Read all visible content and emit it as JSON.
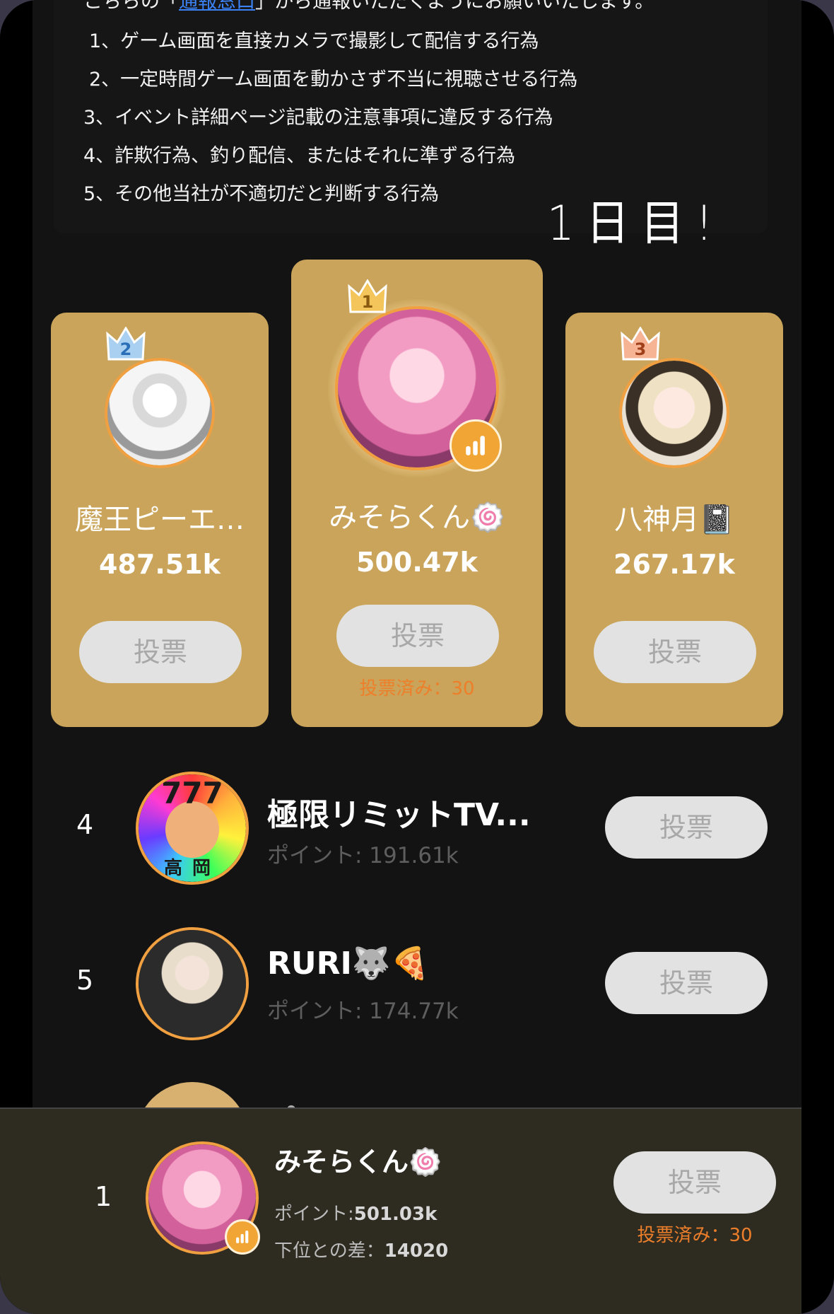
{
  "rules": {
    "line0_prefix": "こちらの「",
    "line0_link": "通報窓口",
    "line0_suffix": "」から通報いただくようにお願いいたします。",
    "items": [
      "1、ゲーム画面を直接カメラで撮影して配信する行為",
      "2、一定時間ゲーム画面を動かさず不当に視聴させる行為",
      "3、イベント詳細ページ記載の注意事項に違反する行為",
      "4、詐欺行為、釣り配信、またはそれに準ずる行為",
      "5、その他当社が不適切だと判断する行為"
    ],
    "handwritten_note": "1日目!"
  },
  "podium": [
    {
      "rank": "2",
      "name": "魔王ピーエ…",
      "score": "487.51k",
      "vote_label": "投票",
      "avatar_colors": [
        "#f4f4f4",
        "#888888"
      ],
      "crown_color": "#9fc9ee"
    },
    {
      "rank": "1",
      "name": "みそらくん",
      "emoji": "🍥",
      "score": "500.47k",
      "vote_label": "投票",
      "voted_text": "投票済み：30",
      "avatar_colors": [
        "#f5a5c8",
        "#b04a78"
      ],
      "crown_color": "#f0c050"
    },
    {
      "rank": "3",
      "name": "八神月",
      "emoji": "📓",
      "score": "267.17k",
      "vote_label": "投票",
      "avatar_colors": [
        "#efe3cf",
        "#6e5a3f"
      ],
      "crown_color": "#f2b08e"
    }
  ],
  "list": [
    {
      "rank": "4",
      "name": "極限リミットTV...",
      "points": "ポイント: 191.61k",
      "vote_label": "投票",
      "avatar_text": "777",
      "avatar_subtext": "高岡"
    },
    {
      "rank": "5",
      "name": "RURI",
      "emoji": "🐺🍕",
      "points": "ポイント: 174.77k",
      "vote_label": "投票"
    }
  ],
  "partial_row": {
    "name": "ぺ"
  },
  "my_rank": {
    "rank": "1",
    "name": "みそらくん",
    "emoji": "🍥",
    "points_label": "ポイント:",
    "points_value": "501.03k",
    "diff_label": "下位との差：",
    "diff_value": "14020",
    "vote_label": "投票",
    "voted_text": "投票済み：30"
  },
  "colors": {
    "card": "#c9a45a",
    "accent_orange": "#ee7f2a",
    "avatar_ring": "#f0a040",
    "link": "#3b82f6"
  }
}
